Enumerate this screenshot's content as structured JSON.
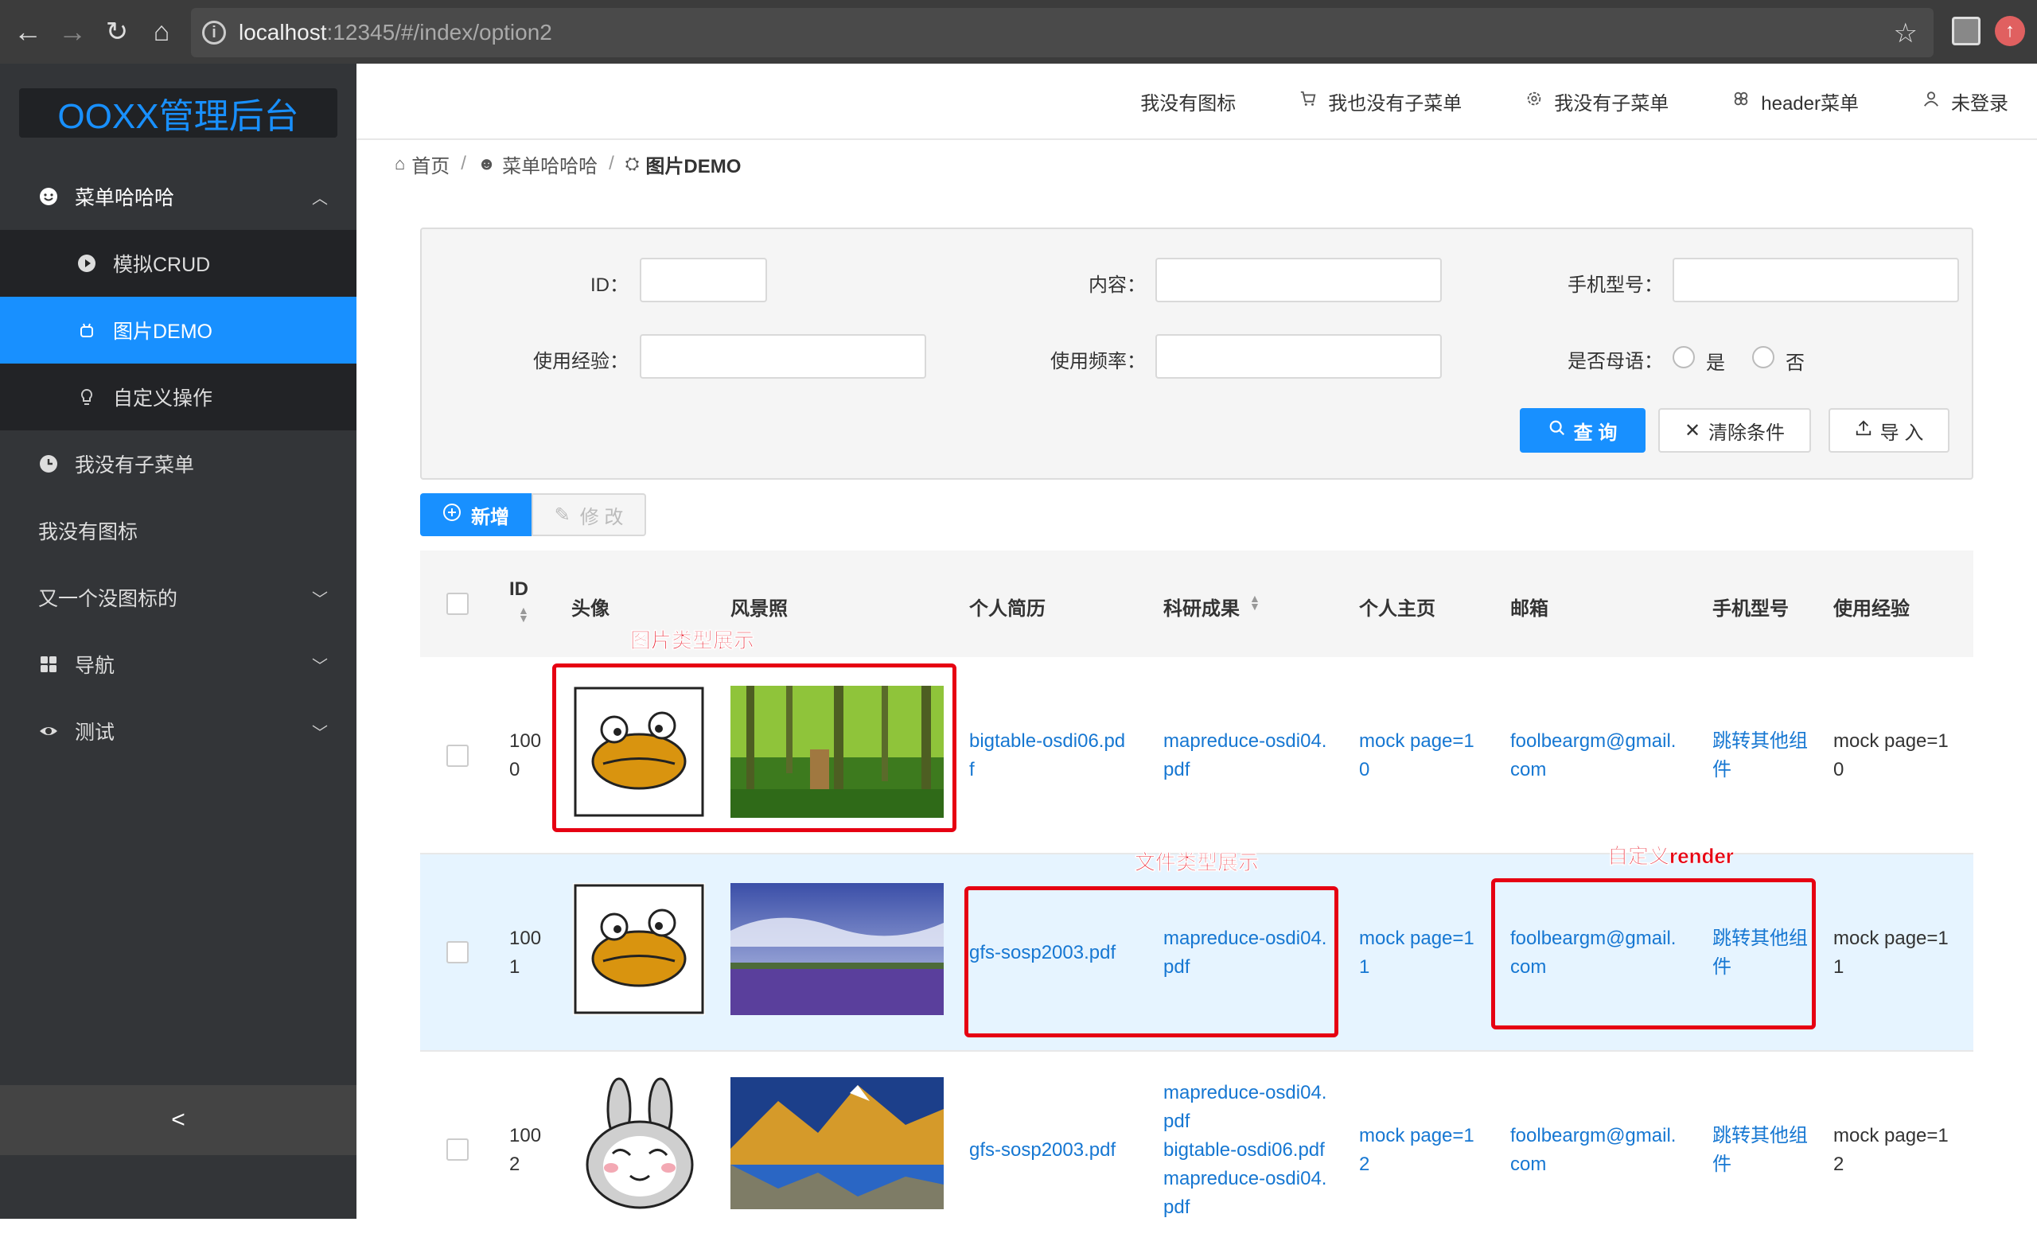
{
  "browser": {
    "host": "localhost",
    "path": ":12345/#/index/option2"
  },
  "sidebar": {
    "logo": "OOXX管理后台",
    "items": [
      {
        "label": "菜单哈哈哈",
        "icon": "smile-icon"
      },
      {
        "label": "模拟CRUD",
        "icon": "play-circle-icon"
      },
      {
        "label": "图片DEMO",
        "icon": "android-icon"
      },
      {
        "label": "自定义操作",
        "icon": "bulb-icon"
      },
      {
        "label": "我没有子菜单",
        "icon": "clock-icon"
      },
      {
        "label": "我没有图标"
      },
      {
        "label": "又一个没图标的"
      },
      {
        "label": "导航",
        "icon": "appstore-icon"
      },
      {
        "label": "测试",
        "icon": "eye-icon"
      }
    ],
    "collapse": "<"
  },
  "header": {
    "items": [
      "我没有图标",
      "我也没有子菜单",
      "我没有子菜单",
      "header菜单",
      "未登录"
    ]
  },
  "breadcrumb": [
    "首页",
    "菜单哈哈哈",
    "图片DEMO"
  ],
  "filter": {
    "id_label": "ID：",
    "content_label": "内容：",
    "phone_label": "手机型号：",
    "exp_label": "使用经验：",
    "freq_label": "使用频率：",
    "native_label": "是否母语：",
    "yes": "是",
    "no": "否",
    "search": "查 询",
    "clear": "清除条件",
    "import": "导 入"
  },
  "actions": {
    "add": "新增",
    "edit": "修 改"
  },
  "table": {
    "headers": [
      "ID",
      "头像",
      "风景照",
      "个人简历",
      "科研成果",
      "个人主页",
      "邮箱",
      "手机型号",
      "使用经验"
    ],
    "rows": [
      {
        "id": [
          "100",
          "0"
        ],
        "resume": [
          "bigtable-osdi06.pd",
          "f"
        ],
        "research": [
          "mapreduce-osdi04.",
          "pdf"
        ],
        "home": [
          "mock page=1",
          "0"
        ],
        "email": [
          "foolbeargm@gmail.",
          "com"
        ],
        "phone": [
          "跳转其他组",
          "件"
        ],
        "exp": [
          "mock page=1",
          "0"
        ]
      },
      {
        "id": [
          "100",
          "1"
        ],
        "resume": [
          "gfs-sosp2003.pdf"
        ],
        "research": [
          "mapreduce-osdi04.",
          "pdf"
        ],
        "home": [
          "mock page=1",
          "1"
        ],
        "email": [
          "foolbeargm@gmail.",
          "com"
        ],
        "phone": [
          "跳转其他组",
          "件"
        ],
        "exp": [
          "mock page=1",
          "1"
        ]
      },
      {
        "id": [
          "100",
          "2"
        ],
        "resume": [
          "gfs-sosp2003.pdf"
        ],
        "research": [
          "mapreduce-osdi04.",
          "pdf",
          "bigtable-osdi06.pdf",
          "mapreduce-osdi04.",
          "pdf"
        ],
        "home": [
          "mock page=1",
          "2"
        ],
        "email": [
          "foolbeargm@gmail.",
          "com"
        ],
        "phone": [
          "跳转其他组",
          "件"
        ],
        "exp": [
          "mock page=1",
          "2"
        ]
      }
    ]
  },
  "annotations": {
    "image": "图片类型展示",
    "file": "文件类型展示",
    "render": "自定义render"
  }
}
